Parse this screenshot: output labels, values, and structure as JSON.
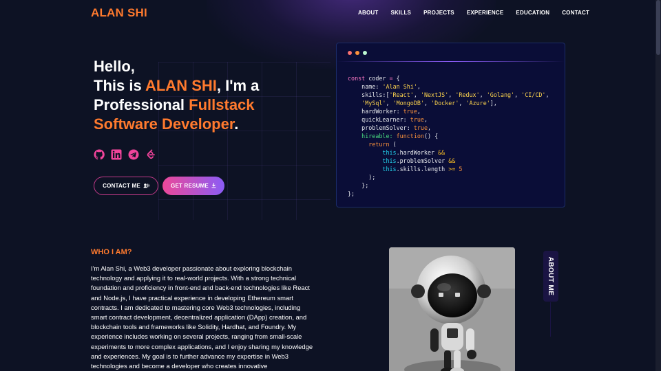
{
  "nav": {
    "logo": "ALAN SHI",
    "links": [
      "ABOUT",
      "SKILLS",
      "PROJECTS",
      "EXPERIENCE",
      "EDUCATION",
      "CONTACT"
    ]
  },
  "hero": {
    "line1": "Hello,",
    "line2_prefix": "This is ",
    "line2_name": "ALAN SHI",
    "line2_suffix": ", I'm a",
    "line3_prefix": "Professional ",
    "line3_accent": "Fullstack",
    "line4_accent": "Software Developer",
    "line4_suffix": "."
  },
  "socials": [
    "github-icon",
    "linkedin-icon",
    "telegram-icon",
    "leetcode-icon"
  ],
  "buttons": {
    "contact": "CONTACT ME",
    "resume": "GET RESUME"
  },
  "code_card": {
    "dot_colors": [
      "#f87171",
      "#fb923c",
      "#bbf7d0"
    ]
  },
  "about": {
    "heading": "WHO I AM?",
    "tab_label": "ABOUT ME",
    "paragraph": "I'm Alan Shi, a Web3 developer passionate about exploring blockchain technology and applying it to real-world projects. With a strong technical foundation and proficiency in front-end and back-end technologies like React and Node.js, I have practical experience in developing Ethereum smart contracts. I am dedicated to mastering core Web3 technologies, including smart contract development, decentralized application (DApp) creation, and blockchain tools and frameworks like Solidity, Hardhat, and Foundry. My experience includes working on several projects, ranging from small-scale experiments to more complex applications, and I enjoy sharing my knowledge and experiences. My goal is to further advance my expertise in Web3 technologies and become a developer who creates innovative"
  },
  "colors": {
    "accent": "#ff7a2e",
    "pink": "#ec4899",
    "violet": "#8b5cf6",
    "background": "#0d1224"
  }
}
